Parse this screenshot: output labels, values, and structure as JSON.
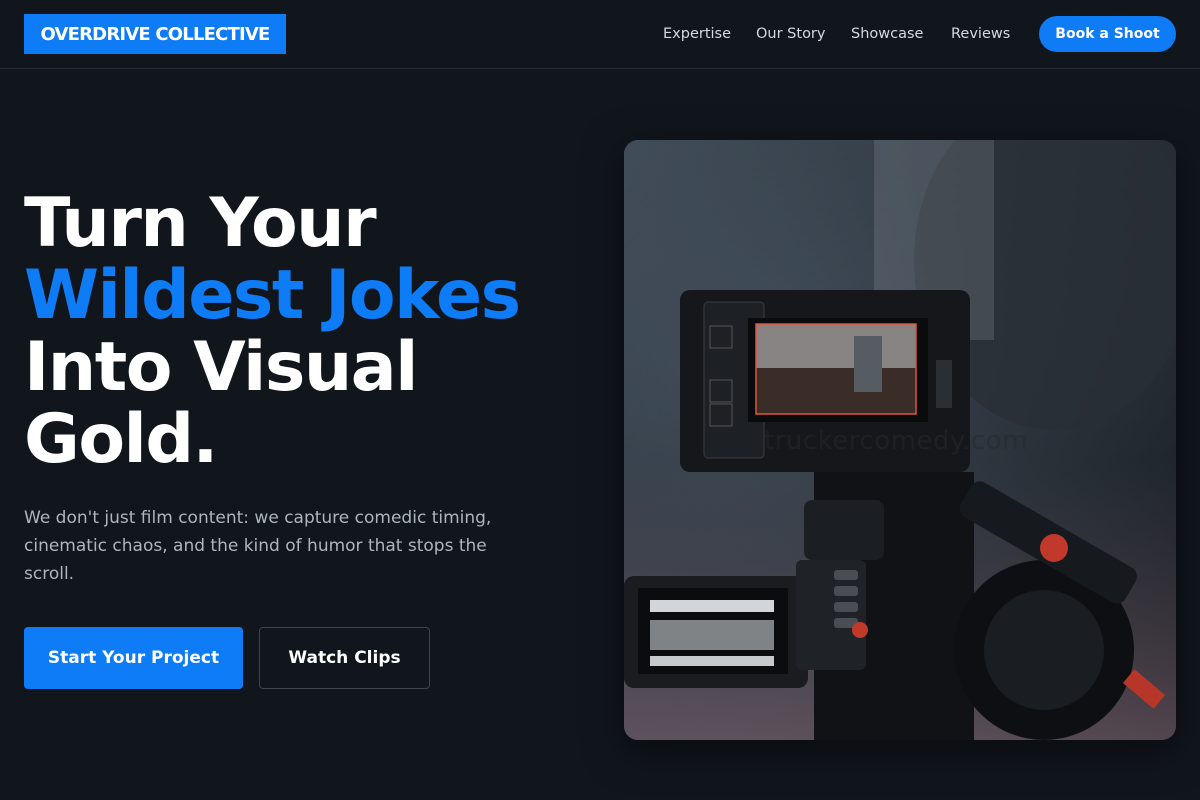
{
  "brand": {
    "logo_text": "OVERDRIVE COLLECTIVE",
    "accent_color": "#0f7cf7"
  },
  "nav": {
    "items": [
      {
        "label": "Expertise"
      },
      {
        "label": "Our Story"
      },
      {
        "label": "Showcase"
      },
      {
        "label": "Reviews"
      }
    ],
    "cta_label": "Book a Shoot"
  },
  "hero": {
    "headline_line1": "Turn Your",
    "headline_line2": "Wildest Jokes",
    "headline_line3": "Into Visual",
    "headline_line4": "Gold.",
    "subtext": "We don't just film content: we capture comedic timing, cinematic chaos, and the kind of humor that stops the scroll.",
    "primary_button": "Start Your Project",
    "secondary_button": "Watch Clips",
    "image_watermark": "truckercomedy.com",
    "image_subject": "cinema camera with external monitor icon"
  }
}
